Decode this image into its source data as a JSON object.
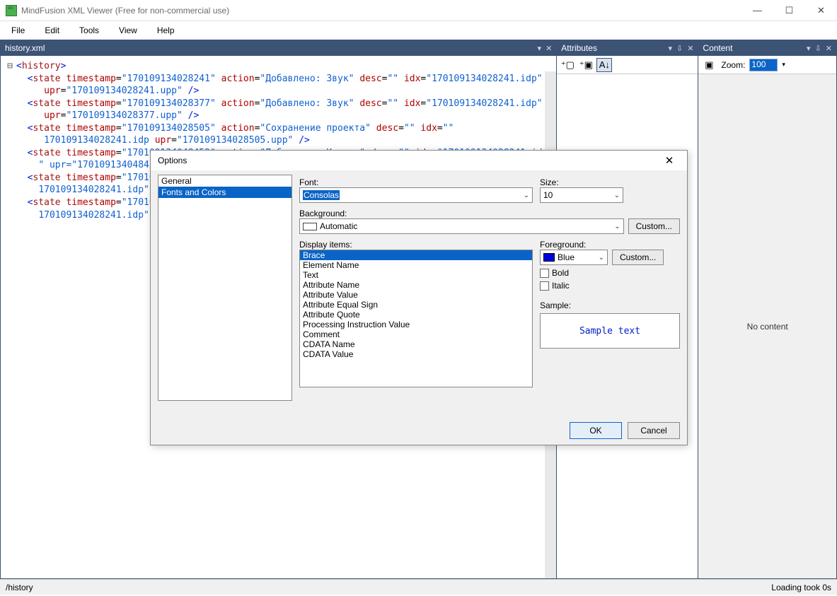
{
  "window": {
    "title": "MindFusion XML Viewer (Free for non-commercial use)"
  },
  "menu": [
    "File",
    "Edit",
    "Tools",
    "View",
    "Help"
  ],
  "tabs": {
    "main": "history.xml"
  },
  "panes": {
    "attributes": "Attributes",
    "content": "Content",
    "zoom_label": "Zoom:",
    "zoom_value": "100",
    "no_content": "No content"
  },
  "xml_lines": [
    {
      "indent": 0,
      "gutter": "⊟",
      "kind": "open",
      "el": "history"
    },
    {
      "indent": 1,
      "gutter": "",
      "kind": "self",
      "el": "state",
      "attrs": [
        [
          "timestamp",
          "170109134028241"
        ],
        [
          "action",
          "Добавлено: Звук"
        ],
        [
          "desc",
          ""
        ],
        [
          "idx",
          "170109134028241.idp"
        ]
      ],
      "wrap_attrs": [
        [
          "upr",
          "170109134028241.upp"
        ]
      ]
    },
    {
      "indent": 1,
      "gutter": "",
      "kind": "self",
      "el": "state",
      "attrs": [
        [
          "timestamp",
          "170109134028377"
        ],
        [
          "action",
          "Добавлено: Звук"
        ],
        [
          "desc",
          ""
        ],
        [
          "idx",
          "170109134028241.idp"
        ]
      ],
      "wrap_attrs": [
        [
          "upr",
          "170109134028377.upp"
        ]
      ]
    },
    {
      "indent": 1,
      "gutter": "",
      "kind": "self",
      "el": "state",
      "attrs": [
        [
          "timestamp",
          "170109134028505"
        ],
        [
          "action",
          "Сохранение проекта"
        ],
        [
          "desc",
          ""
        ],
        [
          "idx",
          ""
        ]
      ],
      "wrap_attrs": [
        [
          "",
          "170109134028241.idp"
        ],
        [
          "upr",
          "170109134028505.upp"
        ]
      ]
    },
    {
      "indent": 1,
      "gutter": "",
      "kind": "partial",
      "el": "state",
      "attrs": [
        [
          "timestamp",
          "170109134048452"
        ],
        [
          "action",
          "Добавлено: Кнопка"
        ],
        [
          "desc",
          ""
        ],
        [
          "idx",
          "170109134028241.idp"
        ]
      ],
      "wrap_text": "\" upr=\"170109134048452."
    },
    {
      "indent": 1,
      "gutter": "",
      "kind": "partial",
      "el": "state",
      "attrs": [
        [
          "timestamp",
          "17010"
        ]
      ],
      "wrap_text": "170109134028241.idp\" "
    },
    {
      "indent": 1,
      "gutter": "",
      "kind": "partial",
      "el": "state",
      "attrs": [
        [
          "timestamp",
          "17010"
        ]
      ],
      "wrap_text": "170109134028241.idp\" up"
    }
  ],
  "options": {
    "title": "Options",
    "nav": [
      "General",
      "Fonts and Colors"
    ],
    "nav_selected": 1,
    "font_label": "Font:",
    "font_value": "Consolas",
    "size_label": "Size:",
    "size_value": "10",
    "bg_label": "Background:",
    "bg_value": "Automatic",
    "custom": "Custom...",
    "display_label": "Display items:",
    "display_items": [
      "Brace",
      "Element Name",
      "Text",
      "Attribute Name",
      "Attribute Value",
      "Attribute Equal Sign",
      "Attribute Quote",
      "Processing Instruction Value",
      "Comment",
      "CDATA Name",
      "CDATA Value"
    ],
    "display_selected": 0,
    "fg_label": "Foreground:",
    "fg_value": "Blue",
    "bold": "Bold",
    "italic": "Italic",
    "sample_label": "Sample:",
    "sample_text": "Sample text",
    "ok": "OK",
    "cancel": "Cancel"
  },
  "status": {
    "path": "/history",
    "loading": "Loading took 0s"
  }
}
